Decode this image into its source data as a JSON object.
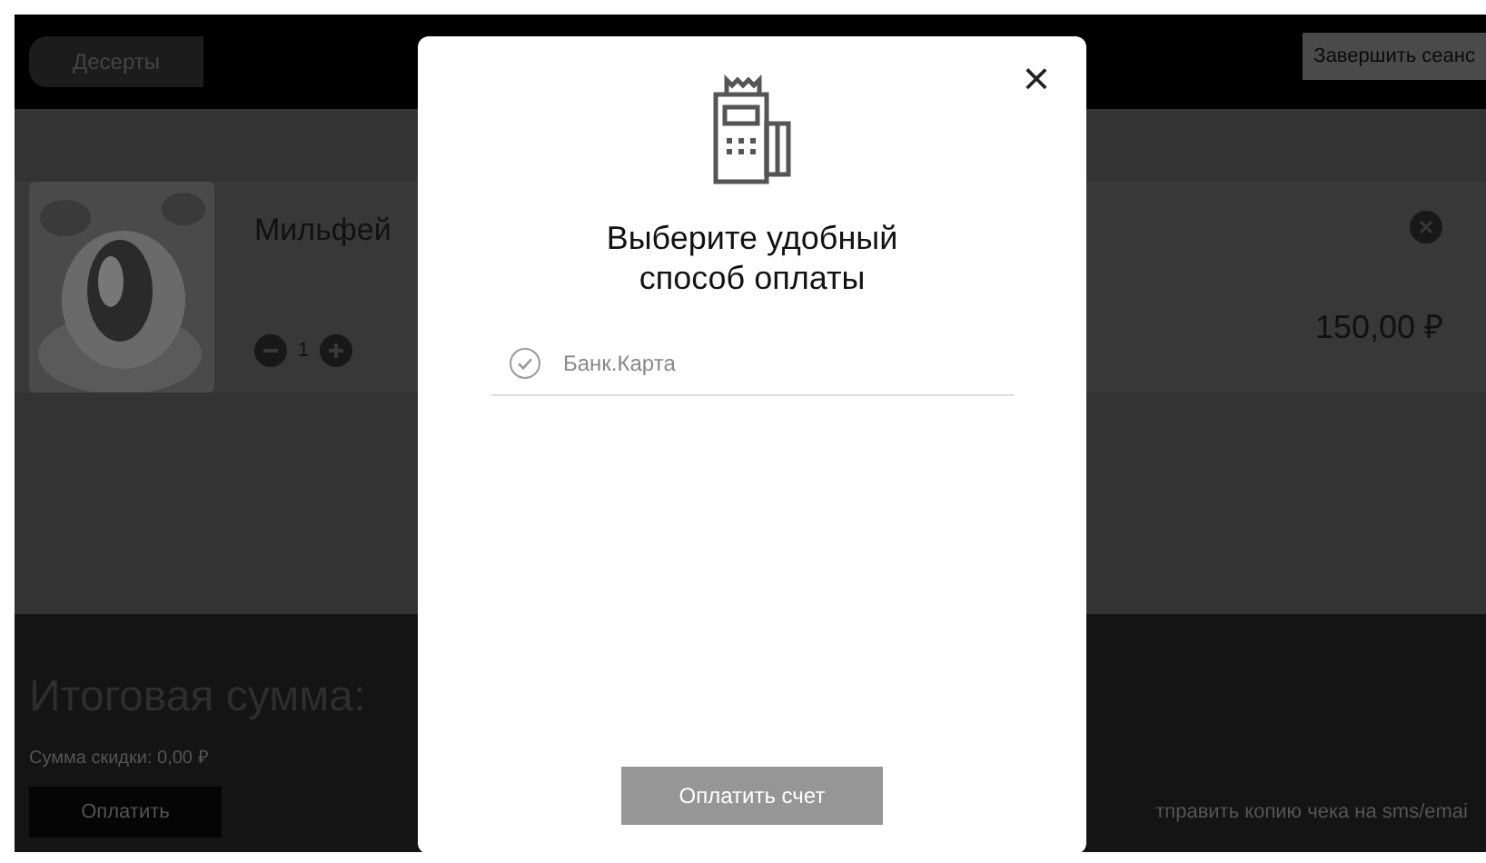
{
  "header": {
    "back_button": "Десерты",
    "end_session_button": "Завершить сеанс"
  },
  "cart_items": [
    {
      "name": "Мильфей",
      "quantity": "1",
      "price": "150,00 ₽"
    }
  ],
  "footer": {
    "total_label": "Итоговая сумма:",
    "discount": "Сумма скидки: 0,00 ₽",
    "pay_button": "Оплатить",
    "send_receipt_link": "тправить копию чека на sms/emai"
  },
  "payment_dialog": {
    "title": "Выберите удобный способ оплаты",
    "close": "×",
    "methods": [
      {
        "label": "Банк.Карта",
        "selected": false
      }
    ],
    "submit_button": "Оплатить счет"
  }
}
